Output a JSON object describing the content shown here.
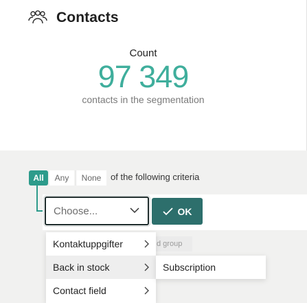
{
  "header": {
    "title": "Contacts",
    "icon": "people-group-icon"
  },
  "count": {
    "label": "Count",
    "value": "97 349",
    "subtitle": "contacts in the segmentation",
    "accent_color": "#3fae9c"
  },
  "criteria": {
    "modes": [
      "All",
      "Any",
      "None"
    ],
    "selected_mode": "All",
    "text": "of the following criteria",
    "accent_color": "#2d9b8b"
  },
  "condition": {
    "select_placeholder": "Choose...",
    "ok_label": "OK",
    "peek_tag": "d group"
  },
  "menu": {
    "items": [
      {
        "label": "Kontaktuppgifter",
        "has_submenu": true
      },
      {
        "label": "Back in stock",
        "has_submenu": true,
        "active": true
      },
      {
        "label": "Contact field",
        "has_submenu": true
      }
    ],
    "submenu_items": [
      {
        "label": "Subscription"
      }
    ]
  }
}
